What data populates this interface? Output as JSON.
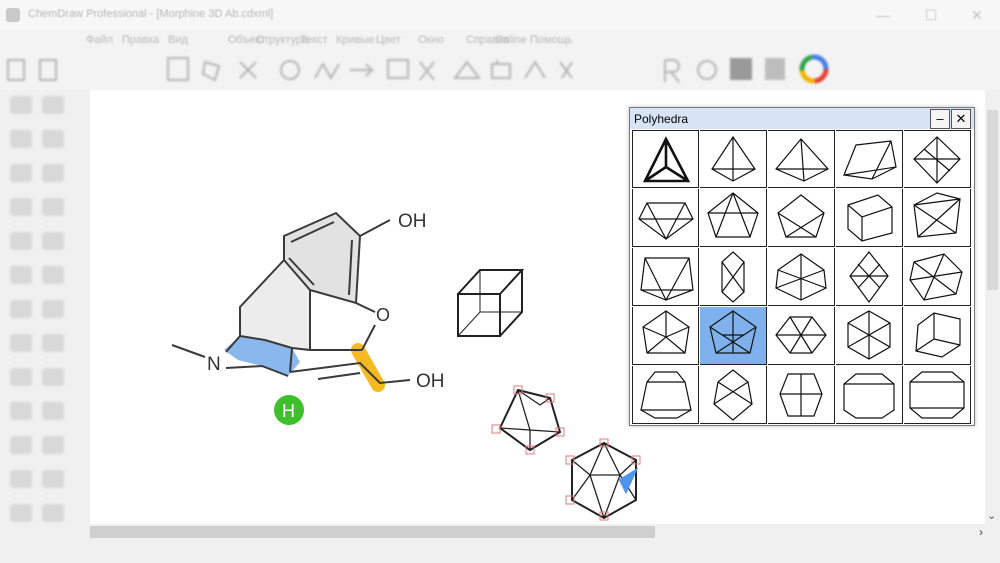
{
  "window": {
    "title": "ChemDraw Professional - [Morphine 3D Ab.cdxml]",
    "minimize_symbol": "—",
    "maximize_symbol": "☐",
    "close_symbol": "✕"
  },
  "menu": {
    "items": [
      "Файл",
      "Правка",
      "Вид",
      "Объект",
      "Структура",
      "Текст",
      "Кривые",
      "Цвет",
      "Окно",
      "Справка",
      "Online",
      "Помощь"
    ]
  },
  "molecule": {
    "labels": {
      "oh_top": "OH",
      "o_ring": "O",
      "oh_right": "OH",
      "n_atom": "N",
      "h_atom": "H"
    },
    "colors": {
      "highlight_blue": "#8ab8ec",
      "highlight_orange": "#f5b922",
      "h_badge_green": "#3fbf2b"
    }
  },
  "polyhedra": {
    "title": "Polyhedra",
    "minimize_symbol": "–",
    "close_symbol": "✕",
    "selected_index": 16,
    "selected_color": "#7fb2ec"
  },
  "scroll": {
    "right_arrow": "›",
    "down_arrow": "⌄"
  }
}
